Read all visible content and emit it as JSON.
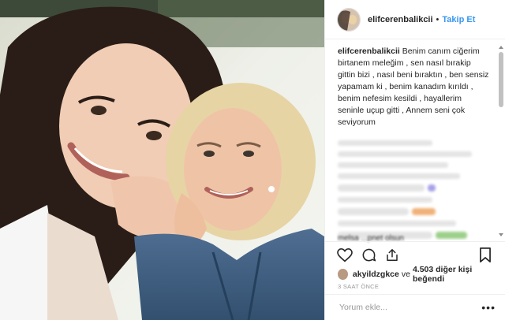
{
  "post": {
    "username": "elifcerenbalikcii",
    "separator": "•",
    "follow_label": "Takip Et",
    "caption_user": "elifcerenbalikcii",
    "caption_text": "Benim canım ciğerim birtanem meleğim , sen nasıl bırakip gittin bizi , nasıl beni bıraktın , ben sensiz yapamam ki , benim kanadım kırıldı , benim nefesim kesildi , hayallerim seninle uçup gitti , Annem seni çok seviyorum",
    "partial_comment": "melsa  ...pnet olsun",
    "liker": "akyildzgkce",
    "likes_and": "ve",
    "likes_other": "4.503 diğer kişi beğendi",
    "time_ago": "3 SAAT ÖNCE",
    "comment_placeholder": "Yorum ekle...",
    "more_label": "•••"
  },
  "icons": {
    "like": "heart-icon",
    "comment": "comment-icon",
    "share": "share-icon",
    "save": "bookmark-icon"
  },
  "colors": {
    "follow": "#3897f0",
    "text": "#262626",
    "muted": "#999999"
  }
}
